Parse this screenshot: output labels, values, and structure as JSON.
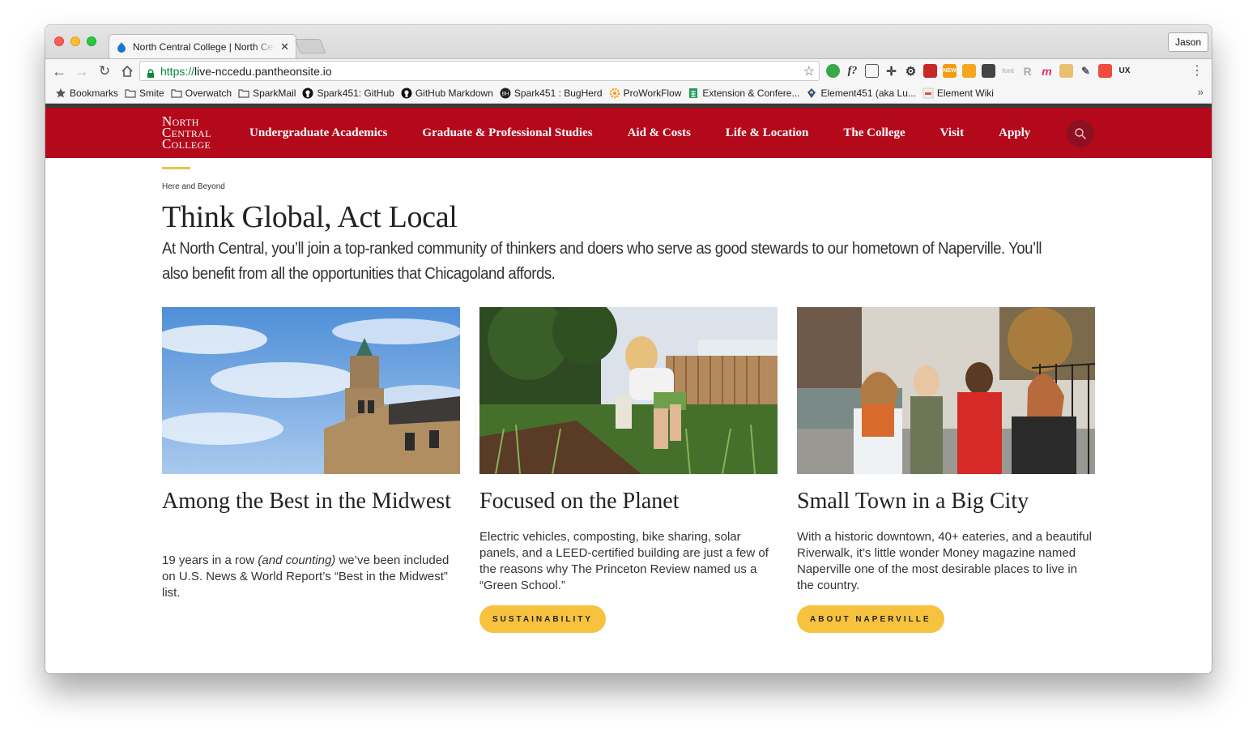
{
  "browser": {
    "tab_title": "North Central College | North Central College",
    "profile_name": "Jason",
    "url_scheme": "https://",
    "url_host": "live-nccedu.pantheonsite.io",
    "bookmarks": [
      {
        "label": "Bookmarks",
        "icon": "star-icon"
      },
      {
        "label": "Smite",
        "icon": "folder-icon"
      },
      {
        "label": "Overwatch",
        "icon": "folder-icon"
      },
      {
        "label": "SparkMail",
        "icon": "folder-icon"
      },
      {
        "label": "Spark451: GitHub",
        "icon": "github-icon"
      },
      {
        "label": "GitHub Markdown",
        "icon": "github-icon"
      },
      {
        "label": "Spark451 : BugHerd",
        "icon": "bugherd-icon"
      },
      {
        "label": "ProWorkFlow",
        "icon": "gear-icon"
      },
      {
        "label": "Extension & Confere...",
        "icon": "sheet-icon"
      },
      {
        "label": "Element451 (aka Lu...",
        "icon": "element-icon"
      },
      {
        "label": "Element Wiki",
        "icon": "wiki-icon"
      }
    ],
    "ext_badge": "NEW",
    "ext_ux": "UX"
  },
  "site": {
    "logo_lines": [
      "North",
      "Central",
      "College"
    ],
    "nav": [
      "Undergraduate Academics",
      "Graduate & Professional Studies",
      "Aid & Costs",
      "Life & Location",
      "The College",
      "Visit",
      "Apply"
    ],
    "eyebrow": "Here and Beyond",
    "heading": "Think Global, Act Local",
    "lede": "At North Central, you’ll join a top-ranked community of thinkers and doers who serve as good stewards to our hometown of Naperville. You’ll also benefit from all the opportunities that Chicagoland affords.",
    "cards": [
      {
        "title": "Among the Best in the Midwest",
        "body_pre": "19 years in a row ",
        "body_em": "(and counting)",
        "body_post": " we’ve been included on U.S. News & World Report’s “Best in the Midwest” list.",
        "button": ""
      },
      {
        "title": "Focused on the Planet",
        "body": "Electric vehicles, composting, bike sharing, solar panels, and a LEED-certified building are just a few of the reasons why The Princeton Review named us a “Green School.”",
        "button": "SUSTAINABILITY"
      },
      {
        "title": "Small Town in a Big City",
        "body": "With a historic downtown, 40+ eateries, and a beautiful Riverwalk, it’s little wonder Money magazine named Naperville one of the most desirable places to live in the country.",
        "button": "ABOUT NAPERVILLE"
      }
    ],
    "colors": {
      "brand_red": "#b4091b",
      "accent_gold": "#f7c23e"
    }
  }
}
